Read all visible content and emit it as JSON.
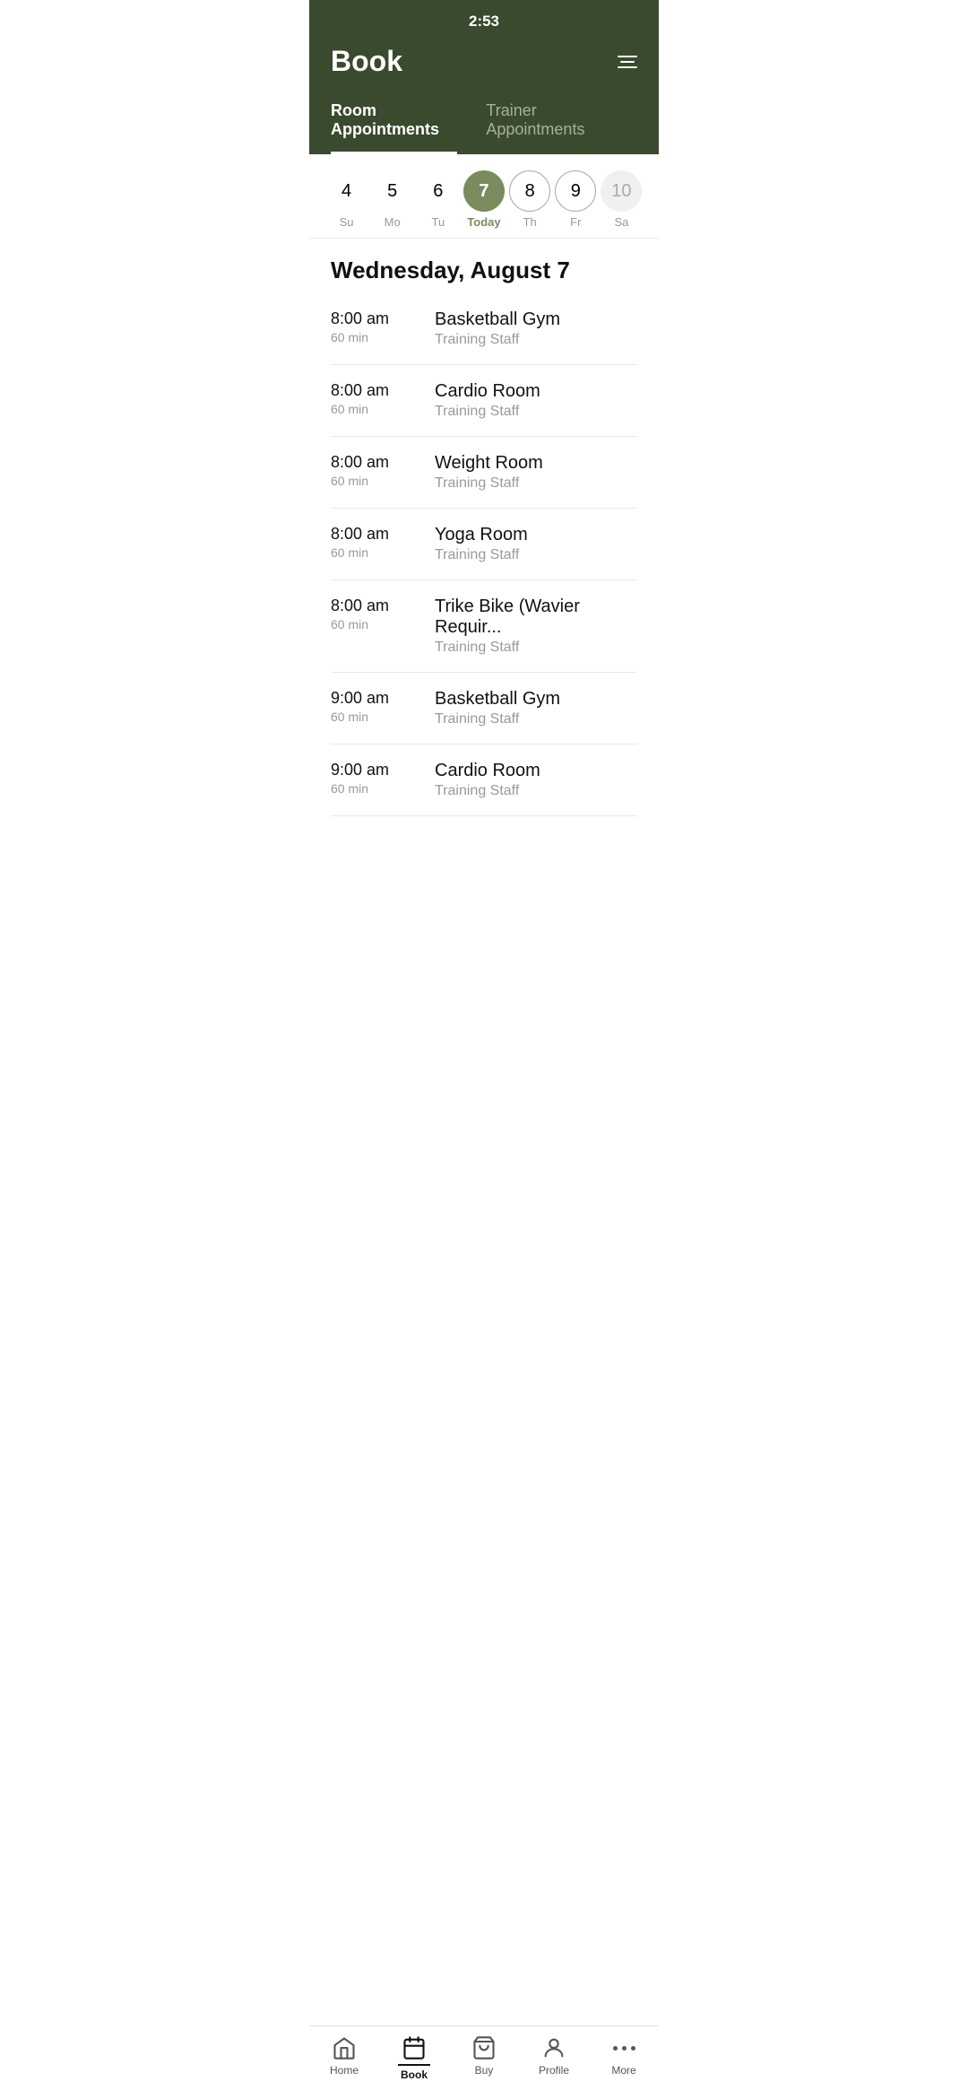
{
  "statusBar": {
    "time": "2:53"
  },
  "header": {
    "title": "Book",
    "filterIcon": "filter-icon"
  },
  "tabs": [
    {
      "id": "room",
      "label": "Room Appointments",
      "active": true
    },
    {
      "id": "trainer",
      "label": "Trainer Appointments",
      "active": false
    }
  ],
  "datePicker": {
    "days": [
      {
        "number": "4",
        "label": "Su",
        "state": "normal"
      },
      {
        "number": "5",
        "label": "Mo",
        "state": "normal"
      },
      {
        "number": "6",
        "label": "Tu",
        "state": "normal"
      },
      {
        "number": "7",
        "label": "Today",
        "state": "today"
      },
      {
        "number": "8",
        "label": "Th",
        "state": "border"
      },
      {
        "number": "9",
        "label": "Fr",
        "state": "border"
      },
      {
        "number": "10",
        "label": "Sa",
        "state": "muted"
      }
    ]
  },
  "dateHeading": "Wednesday, August 7",
  "appointments": [
    {
      "time": "8:00 am",
      "duration": "60 min",
      "name": "Basketball Gym",
      "staff": "Training Staff"
    },
    {
      "time": "8:00 am",
      "duration": "60 min",
      "name": "Cardio Room",
      "staff": "Training Staff"
    },
    {
      "time": "8:00 am",
      "duration": "60 min",
      "name": "Weight Room",
      "staff": "Training Staff"
    },
    {
      "time": "8:00 am",
      "duration": "60 min",
      "name": "Yoga Room",
      "staff": "Training Staff"
    },
    {
      "time": "8:00 am",
      "duration": "60 min",
      "name": "Trike Bike (Wavier Requir...",
      "staff": "Training Staff"
    },
    {
      "time": "9:00 am",
      "duration": "60 min",
      "name": "Basketball Gym",
      "staff": "Training Staff"
    },
    {
      "time": "9:00 am",
      "duration": "60 min",
      "name": "Cardio Room",
      "staff": "Training Staff"
    }
  ],
  "bottomNav": [
    {
      "id": "home",
      "label": "Home",
      "icon": "home",
      "active": false
    },
    {
      "id": "book",
      "label": "Book",
      "icon": "book",
      "active": true
    },
    {
      "id": "buy",
      "label": "Buy",
      "icon": "buy",
      "active": false
    },
    {
      "id": "profile",
      "label": "Profile",
      "icon": "profile",
      "active": false
    },
    {
      "id": "more",
      "label": "More",
      "icon": "more",
      "active": false
    }
  ]
}
